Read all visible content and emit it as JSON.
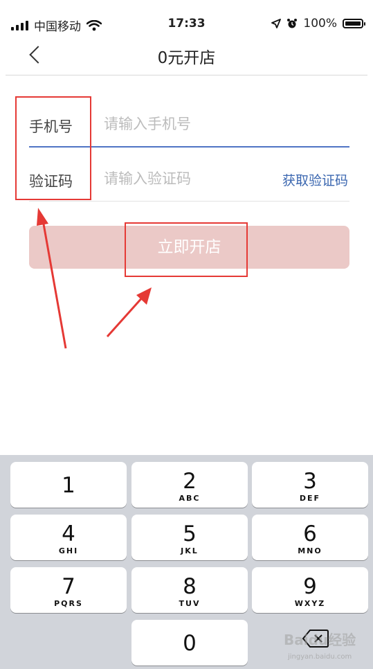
{
  "status_bar": {
    "carrier": "中国移动",
    "time": "17:33",
    "battery": "100%"
  },
  "nav": {
    "title": "0元开店"
  },
  "form": {
    "phone_label": "手机号",
    "phone_placeholder": "请输入手机号",
    "code_label": "验证码",
    "code_placeholder": "请输入验证码",
    "get_code": "获取验证码",
    "submit": "立即开店"
  },
  "keyboard": {
    "keys": [
      {
        "num": "1",
        "letters": ""
      },
      {
        "num": "2",
        "letters": "ABC"
      },
      {
        "num": "3",
        "letters": "DEF"
      },
      {
        "num": "4",
        "letters": "GHI"
      },
      {
        "num": "5",
        "letters": "JKL"
      },
      {
        "num": "6",
        "letters": "MNO"
      },
      {
        "num": "7",
        "letters": "PQRS"
      },
      {
        "num": "8",
        "letters": "TUV"
      },
      {
        "num": "9",
        "letters": "WXYZ"
      },
      {
        "num": "0",
        "letters": ""
      }
    ]
  },
  "watermark": {
    "text": "Baidu经验",
    "url": "jingyan.baidu.com"
  },
  "colors": {
    "accent": "#4f74c4",
    "link": "#3b67b0",
    "button": "#ebc9c7",
    "annotation": "#e53935"
  }
}
